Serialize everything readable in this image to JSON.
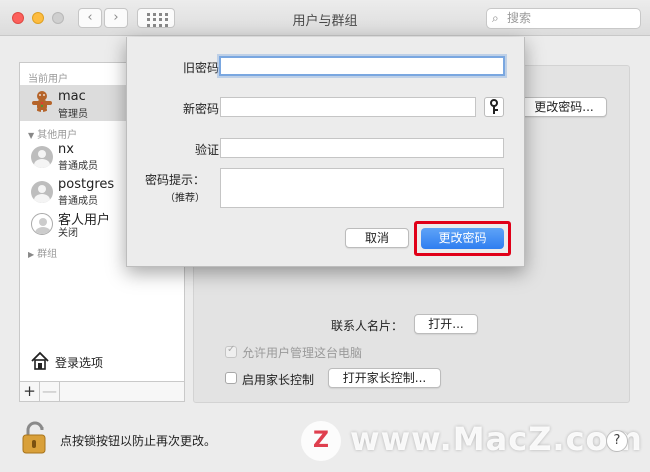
{
  "window": {
    "title": "用户与群组"
  },
  "search": {
    "placeholder": "搜索"
  },
  "sidebar": {
    "current_header": "当前用户",
    "other_header": "其他用户",
    "groups_label": "群组",
    "users": [
      {
        "name": "mac",
        "role": "管理员",
        "avatar": "gingerbread-avatar"
      },
      {
        "name": "nx",
        "role": "普通成员",
        "avatar": "user-silhouette-icon"
      },
      {
        "name": "postgres",
        "role": "普通成员",
        "avatar": "user-silhouette-icon"
      },
      {
        "name": "客人用户",
        "role": "关闭",
        "avatar": "guest-user-icon"
      }
    ],
    "login_options": "登录选项",
    "add": "+",
    "remove": "—"
  },
  "main": {
    "change_password_button": "更改密码...",
    "contact_card_label": "联系人名片：",
    "open_button": "打开...",
    "allow_admin_label": "允许用户管理这台电脑",
    "parental_label": "启用家长控制",
    "open_parental_button": "打开家长控制...",
    "lock_text": "点按锁按钮以防止再次更改。",
    "help": "?"
  },
  "sheet": {
    "old_password_label": "旧密码：",
    "new_password_label": "新密码：",
    "verify_label": "验证：",
    "hint_label": "密码提示：",
    "hint_sub_label": "（推荐）",
    "old_password_value": "",
    "new_password_value": "",
    "verify_value": "",
    "hint_value": "",
    "cancel_button": "取消",
    "confirm_button": "更改密码"
  },
  "watermark": {
    "logo_letter": "Z",
    "text": "www.MacZ.com"
  },
  "colors": {
    "accent": "#2f7ef0",
    "highlight_box": "#e00018",
    "focus_ring": "#7aa7e0"
  }
}
